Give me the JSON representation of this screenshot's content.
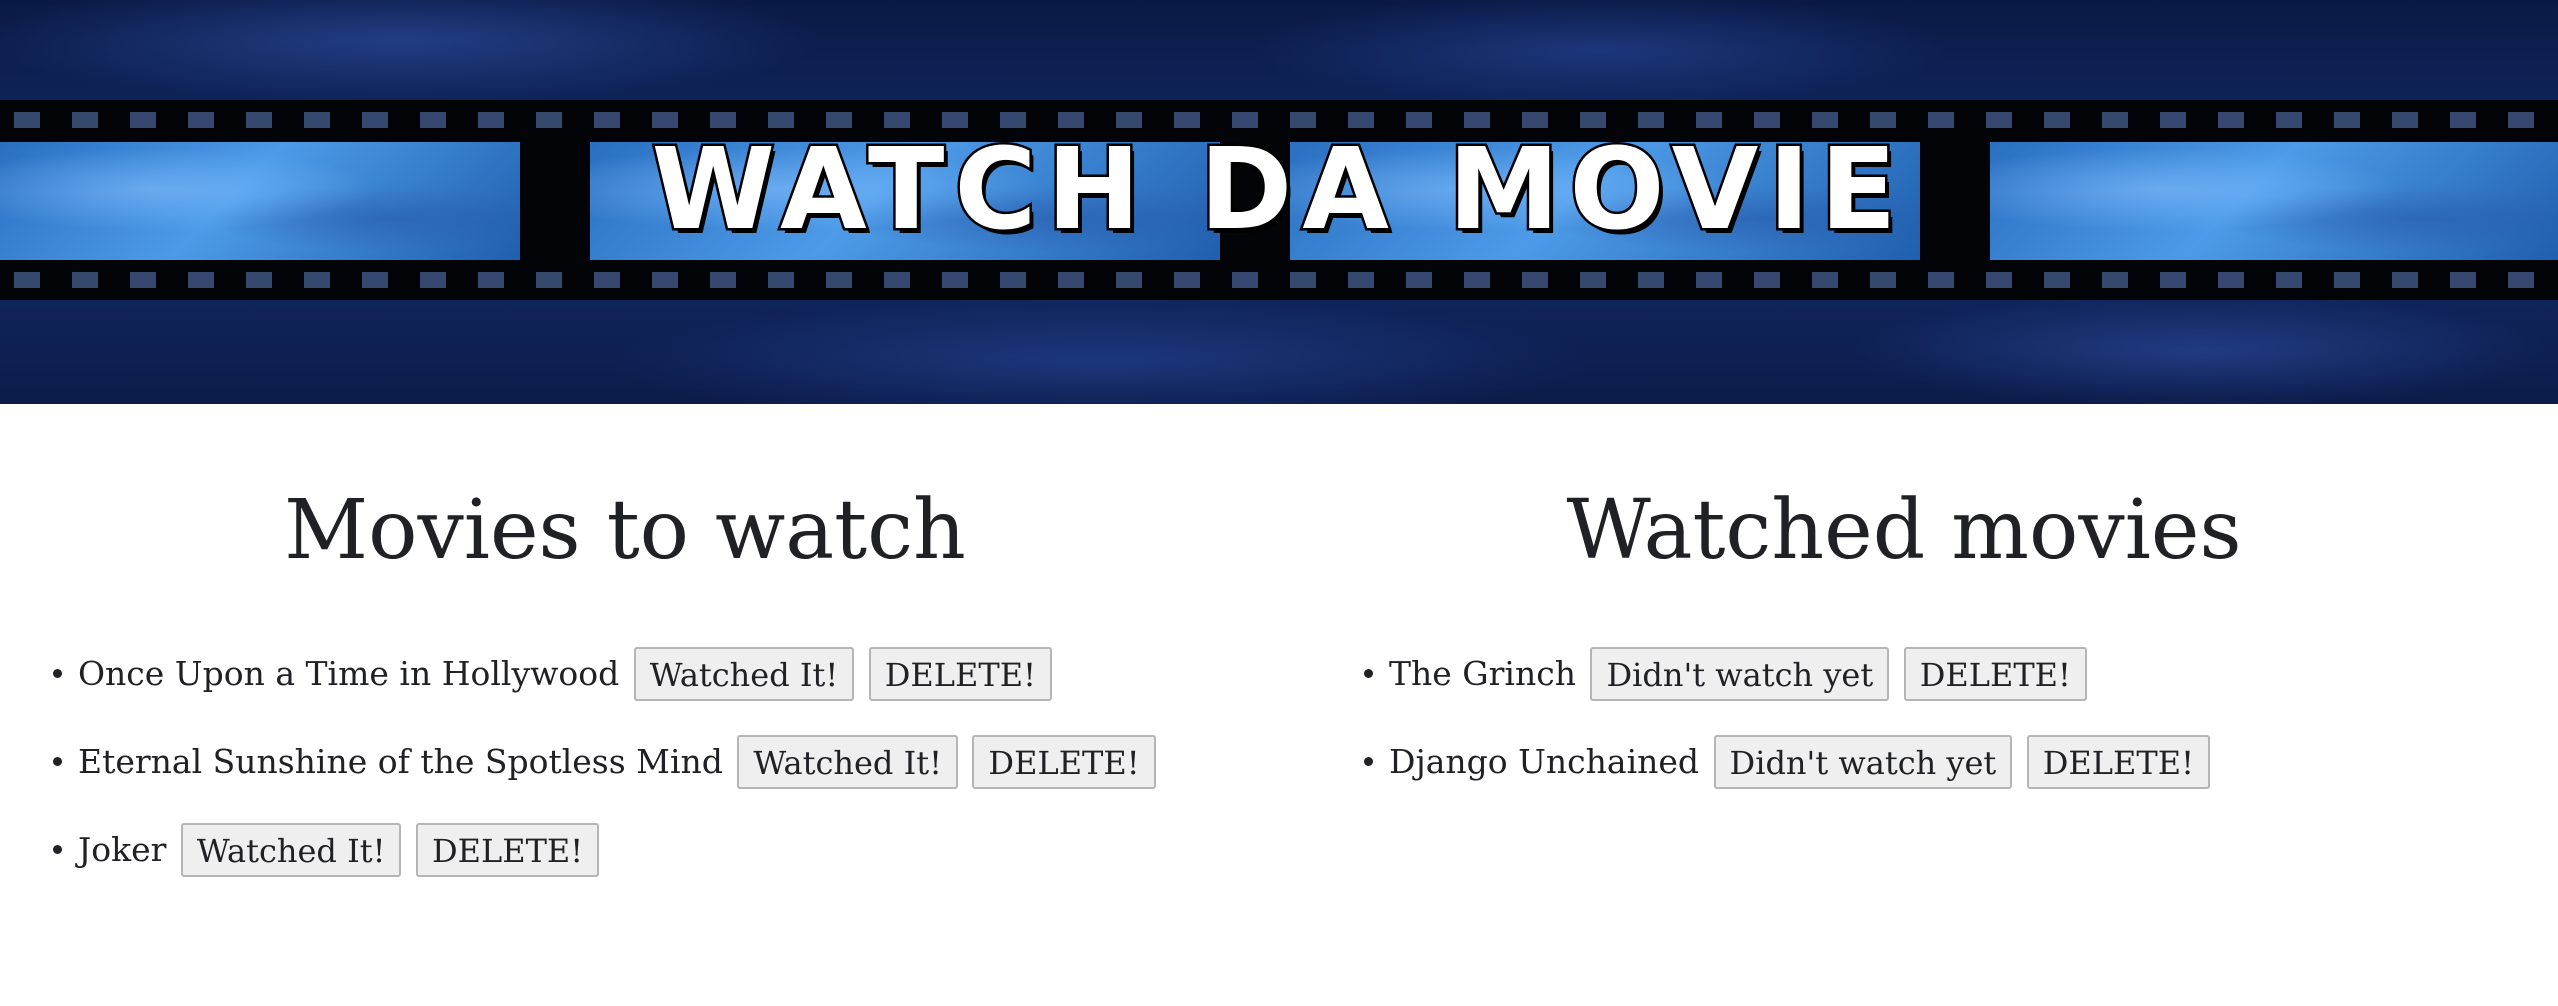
{
  "banner": {
    "title": "WATCH DA MOVIE"
  },
  "to_watch": {
    "heading": "Movies to watch",
    "items": [
      {
        "title": "Once Upon a Time in Hollywood",
        "action_label": "Watched It!",
        "delete_label": "DELETE!"
      },
      {
        "title": "Eternal Sunshine of the Spotless Mind",
        "action_label": "Watched It!",
        "delete_label": "DELETE!"
      },
      {
        "title": "Joker",
        "action_label": "Watched It!",
        "delete_label": "DELETE!"
      }
    ]
  },
  "watched": {
    "heading": "Watched movies",
    "items": [
      {
        "title": "The Grinch",
        "action_label": "Didn't watch yet",
        "delete_label": "DELETE!"
      },
      {
        "title": "Django Unchained",
        "action_label": "Didn't watch yet",
        "delete_label": "DELETE!"
      }
    ]
  }
}
